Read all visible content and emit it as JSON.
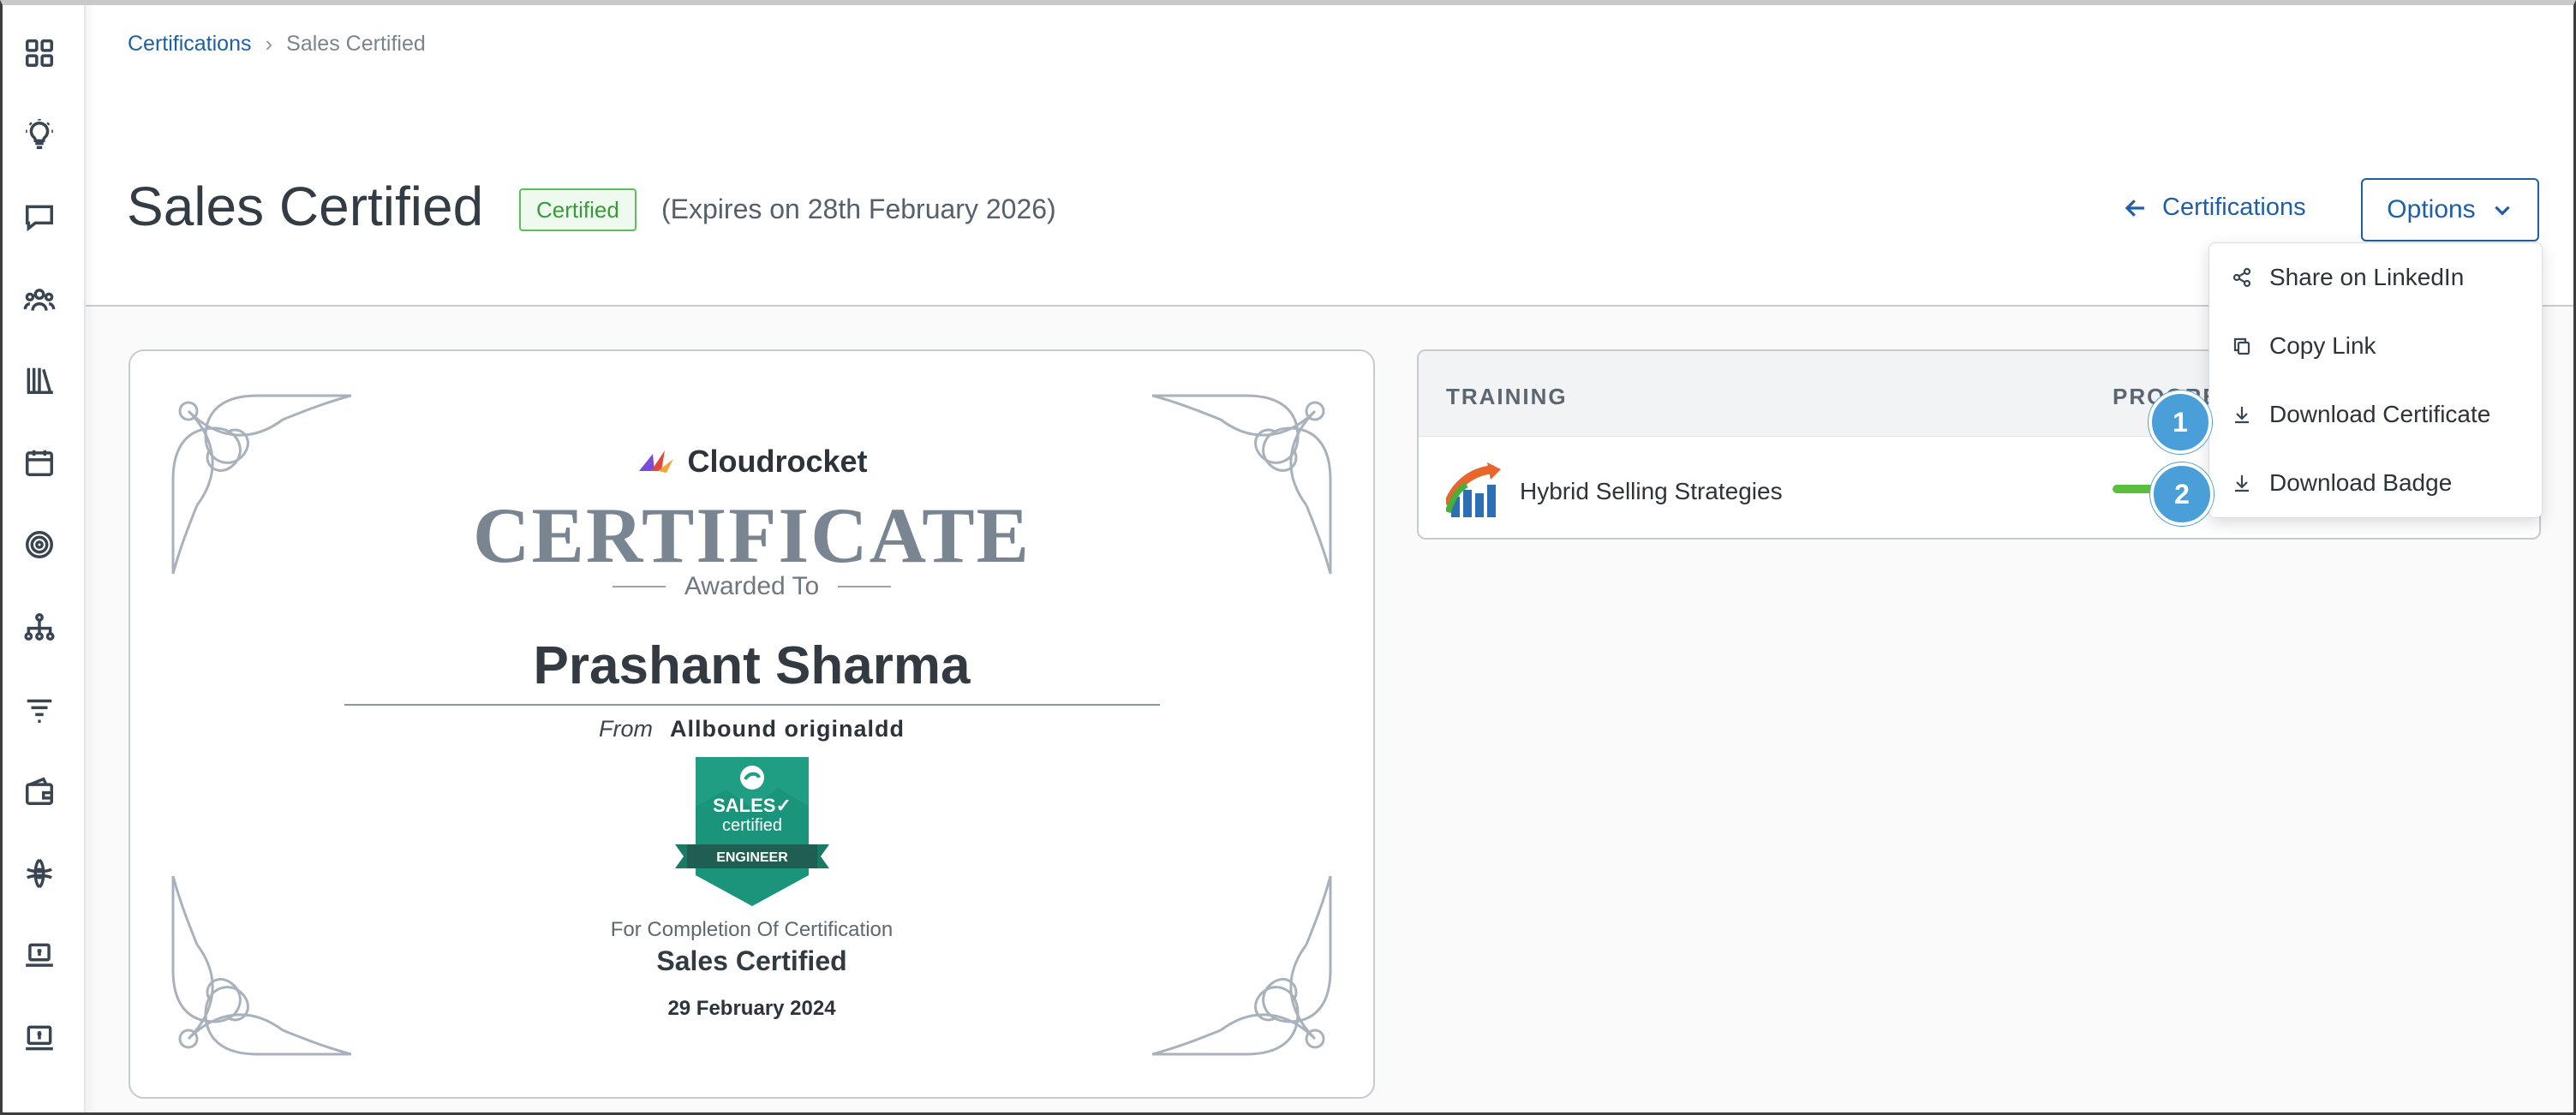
{
  "breadcrumb": {
    "parent": "Certifications",
    "current": "Sales Certified"
  },
  "header": {
    "title": "Sales Certified",
    "status": "Certified",
    "expiry": "(Expires on 28th February 2026)",
    "back_label": "Certifications",
    "options_label": "Options"
  },
  "sidebar": {
    "icons": [
      "grid-icon",
      "lightbulb-icon",
      "chat-icon",
      "users-icon",
      "library-icon",
      "calendar-icon",
      "target-icon",
      "org-chart-icon",
      "funnel-icon",
      "wallet-icon",
      "network-icon",
      "laptop-dollar-icon",
      "monitor-dollar-icon"
    ]
  },
  "certificate": {
    "brand": "Cloudrocket",
    "heading": "CERTIFICATE",
    "awarded_to": "Awarded To",
    "recipient": "Prashant Sharma",
    "from_label": "From",
    "from_org": "Allbound originaldd",
    "badge": {
      "line1": "SALES✓",
      "line2": "certified",
      "ribbon": "ENGINEER"
    },
    "completion_text": "For Completion Of Certification",
    "certification_name": "Sales Certified",
    "date": "29 February 2024"
  },
  "training": {
    "columns": [
      "TRAINING",
      "PROGRE"
    ],
    "rows": [
      {
        "name": "Hybrid Selling Strategies",
        "progress": 1.0
      }
    ]
  },
  "options_menu": {
    "items": [
      {
        "label": "Share on LinkedIn",
        "icon": "share-icon"
      },
      {
        "label": "Copy Link",
        "icon": "copy-icon"
      },
      {
        "label": "Download Certificate",
        "icon": "download-icon"
      },
      {
        "label": "Download Badge",
        "icon": "download-icon"
      }
    ]
  },
  "markers": [
    "1",
    "2"
  ],
  "colors": {
    "accent": "#1f5fa8",
    "certified_green": "#3a9a3a",
    "marker_blue": "#4a9fd8",
    "progress_green": "#5abf3d"
  }
}
